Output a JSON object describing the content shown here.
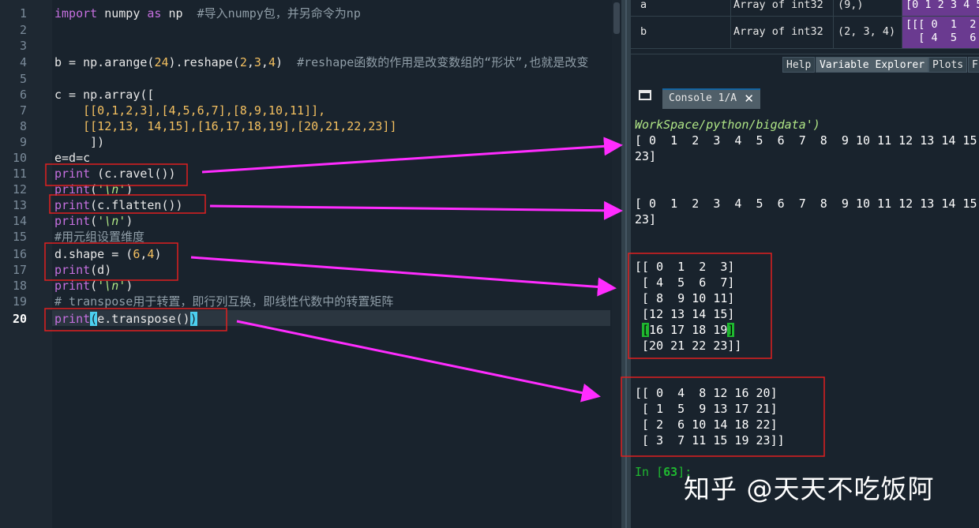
{
  "editor": {
    "line_numbers": [
      "1",
      "2",
      "3",
      "4",
      "5",
      "6",
      "7",
      "8",
      "9",
      "10",
      "11",
      "12",
      "13",
      "14",
      "15",
      "16",
      "17",
      "18",
      "19",
      "20"
    ],
    "active_line": "20",
    "lines": {
      "l1": {
        "kw1": "import",
        "sp1": " numpy ",
        "kw2": "as",
        "sp2": " np  ",
        "cm": "#导入numpy包，并另命令为np"
      },
      "l4": {
        "a": "b = np.arange(",
        "n1": "24",
        "b": ").reshape(",
        "n2": "2",
        "c": ",",
        "n3": "3",
        "d": ",",
        "n4": "4",
        "e": ")  ",
        "cm": "#reshape函数的作用是改变数组的“形状”,也就是改变"
      },
      "l6": {
        "a": "c = np.array(["
      },
      "l7": {
        "text": "    [[0,1,2,3],[4,5,6,7],[8,9,10,11]],"
      },
      "l8": {
        "text": "    [[12,13, 14,15],[16,17,18,19],[20,21,22,23]]"
      },
      "l9": {
        "text": "     ])"
      },
      "l10": {
        "text": "e=d=c"
      },
      "l11": {
        "fn": "print",
        "rest": " (c.ravel())"
      },
      "l12": {
        "fn": "print",
        "p": "(",
        "st": "'\\n'",
        "q": ")"
      },
      "l13": {
        "fn": "print",
        "rest": "(c.flatten())"
      },
      "l14": {
        "fn": "print",
        "p": "(",
        "st": "'\\n'",
        "q": ")"
      },
      "l15": {
        "cm": "#用元组设置维度"
      },
      "l16": {
        "a": "d.shape = (",
        "n1": "6",
        "b": ",",
        "n2": "4",
        "c": ")"
      },
      "l17": {
        "fn": "print",
        "rest": "(d)"
      },
      "l18": {
        "fn": "print",
        "p": "(",
        "st": "'\\n'",
        "q": ")"
      },
      "l19": {
        "cm": "# transpose用于转置，即行列互换，即线性代数中的转置矩阵"
      },
      "l20": {
        "fn": "print",
        "p": "(",
        "rest": "e.transpose()",
        "q": ")"
      }
    }
  },
  "variable_explorer": {
    "rows": [
      {
        "name": "a",
        "type": "Array of int32",
        "size": "(9,)",
        "value": "[0 1 2 3 4 5"
      },
      {
        "name": "b",
        "type": "Array of int32",
        "size": "(2, 3, 4)",
        "value": "[[[ 0  1  2\n  [ 4  5  6"
      }
    ]
  },
  "pane_tabs": [
    "Help",
    "Variable Explorer",
    "Plots",
    "F"
  ],
  "console": {
    "tab_label": "Console 1/A",
    "close": "✕",
    "path_line": "WorkSpace/python/bigdata')",
    "ravel_1": "[ 0  1  2  3  4  5  6  7  8  9 10 11 12 13 14 15",
    "ravel_2": "23]",
    "flatten_1": "[ 0  1  2  3  4  5  6  7  8  9 10 11 12 13 14 15",
    "flatten_2": "23]",
    "d_rows": [
      "[[ 0  1  2  3]",
      " [ 4  5  6  7]",
      " [ 8  9 10 11]",
      " [12 13 14 15]",
      " ",
      "16 17 18 19",
      " [20 21 22 23]]"
    ],
    "d_row5_open": "[",
    "d_row5_body": "16 17 18 19",
    "d_row5_close": "]",
    "t_rows": [
      "[[ 0  4  8 12 16 20]",
      " [ 1  5  9 13 17 21]",
      " [ 2  6 10 14 18 22]",
      " [ 3  7 11 15 19 23]]"
    ],
    "prompt_in": "In [",
    "prompt_num": "63",
    "prompt_end": "]:"
  },
  "watermark": "知乎 @天天不吃饭阿",
  "colors": {
    "annotation": "#ff2cff",
    "box": "#e02020",
    "bg": "#19232d"
  }
}
